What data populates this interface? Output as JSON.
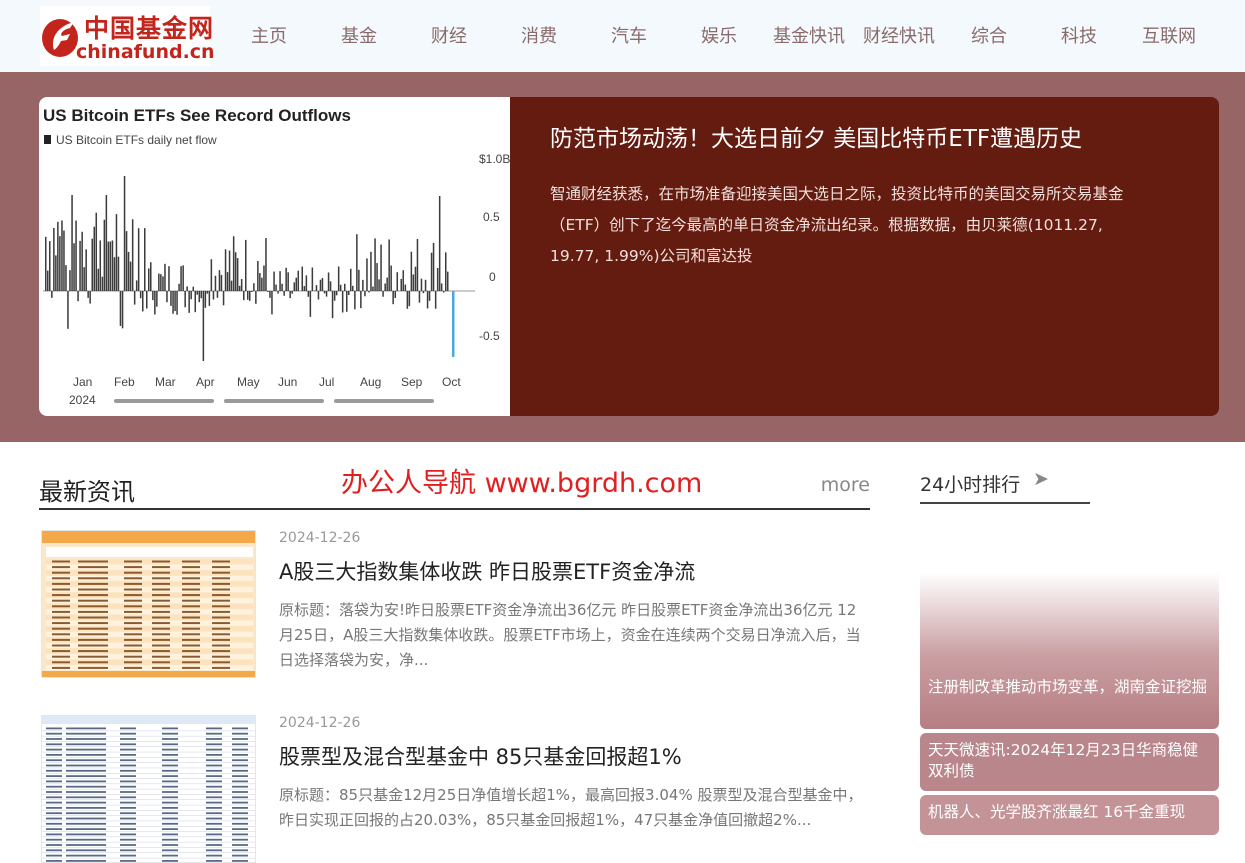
{
  "header": {
    "logo_cn": "中国基金网",
    "logo_en": "chinafund.cn",
    "nav": [
      "主页",
      "基金",
      "财经",
      "消费",
      "汽车",
      "娱乐",
      "基金快讯",
      "财经快讯",
      "综合",
      "科技",
      "互联网"
    ]
  },
  "hero": {
    "image": {
      "title": "US Bitcoin ETFs See Record Outflows",
      "legend": "US Bitcoin ETFs daily net flow",
      "y_ticks": [
        "$1.0B",
        "0.5",
        "0",
        "-0.5"
      ],
      "x_ticks": [
        "Jan",
        "Feb",
        "Mar",
        "Apr",
        "May",
        "Jun",
        "Jul",
        "Aug",
        "Sep",
        "Oct"
      ],
      "year": "2024"
    },
    "title": "防范市场动荡！大选日前夕 美国比特币ETF遭遇历史",
    "summary": "智通财经获悉，在市场准备迎接美国大选日之际，投资比特币的美国交易所交易基金（ETF）创下了迄今最高的单日资金净流出纪录。根据数据，由贝莱德(1011.27, 19.77, 1.99%)公司和富达投",
    "slide_count": 3
  },
  "latest": {
    "title": "最新资讯",
    "watermark": "办公人导航 www.bgrdh.com",
    "more": "more",
    "articles": [
      {
        "date": "2024-12-26",
        "title": "A股三大指数集体收跌 昨日股票ETF资金净流",
        "summary": "原标题：落袋为安!昨日股票ETF资金净流出36亿元 昨日股票ETF资金净流出36亿元 12月25日，A股三大指数集体收跌。股票ETF市场上，资金在连续两个交易日净流入后，当日选择落袋为安，净..."
      },
      {
        "date": "2024-12-26",
        "title": "股票型及混合型基金中 85只基金回报超1%",
        "summary": "原标题：85只基金12月25日净值增长超1%，最高回报3.04% 股票型及混合型基金中，昨日实现正回报的占20.03%，85只基金回报超1%，47只基金净值回撤超2%..."
      }
    ]
  },
  "ranking": {
    "title": "24小时排行",
    "arrow": "➤",
    "items": [
      "注册制改革推动市场变革，湖南金证挖掘",
      "天天微速讯:2024年12月23日华商稳健双利债",
      "机器人、光学股齐涨最红 16千金重现"
    ]
  },
  "colors": {
    "header_bg": "#f3f9fc",
    "brand_red": "#c3251d",
    "hero_bg": "#976565",
    "hero_card": "#641b10",
    "rank_card": "#b0787d"
  }
}
